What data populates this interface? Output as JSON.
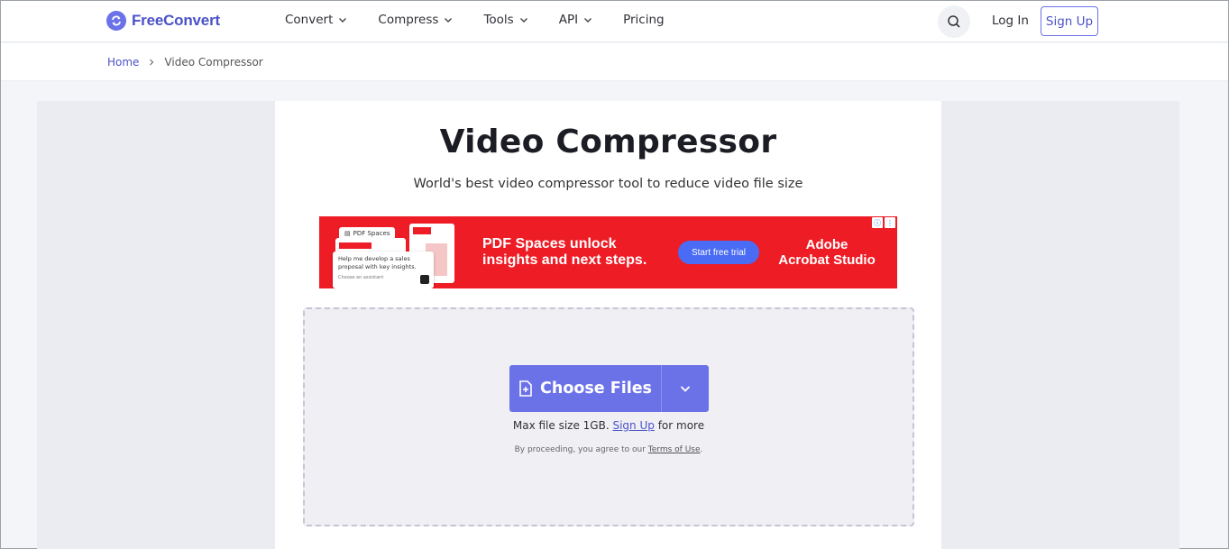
{
  "brand": {
    "name": "FreeConvert",
    "accent": "#6b72e8",
    "logo_icon": "refresh-arrows-icon"
  },
  "nav": {
    "items": [
      {
        "label": "Convert",
        "has_dropdown": true
      },
      {
        "label": "Compress",
        "has_dropdown": true
      },
      {
        "label": "Tools",
        "has_dropdown": true
      },
      {
        "label": "API",
        "has_dropdown": true
      },
      {
        "label": "Pricing",
        "has_dropdown": false
      }
    ],
    "search_icon": "search-icon",
    "login_label": "Log In",
    "signup_label": "Sign Up"
  },
  "breadcrumb": {
    "home": "Home",
    "current": "Video Compressor"
  },
  "hero": {
    "title": "Video Compressor",
    "subtitle": "World's best video compressor tool to reduce video file size"
  },
  "ad": {
    "background": "#ee1c25",
    "chip_label": "PDF Spaces",
    "prompt_text": "Help me develop a sales proposal with key insights.",
    "prompt_meta": "Choose an assistant",
    "headline_line1": "PDF Spaces unlock",
    "headline_line2": "insights and next steps.",
    "cta_label": "Start free trial",
    "brand_line1": "Adobe",
    "brand_line2": "Acrobat Studio",
    "info_icon": "info-icon",
    "menu_icon": "more-vertical-icon"
  },
  "upload": {
    "button_label": "Choose Files",
    "button_icon": "file-plus-icon",
    "dropdown_icon": "chevron-down-icon",
    "limit_prefix": "Max file size 1GB.",
    "limit_link": "Sign Up",
    "limit_suffix": "for more",
    "terms_prefix": "By proceeding, you agree to our",
    "terms_link": "Terms of Use",
    "terms_suffix": "."
  }
}
